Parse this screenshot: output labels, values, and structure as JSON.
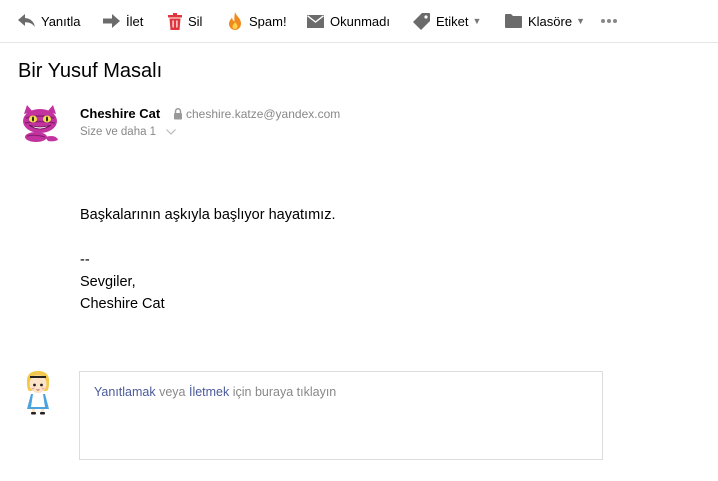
{
  "toolbar": {
    "reply": "Yanıtla",
    "forward": "İlet",
    "delete": "Sil",
    "spam": "Spam!",
    "unread": "Okunmadı",
    "label": "Etiket",
    "folder": "Klasöre",
    "more_icon": "more-dots-icon"
  },
  "colors": {
    "delete_red": "#e0353d",
    "spam_orange": "#f08a1c",
    "icon_gray": "#6b6b6b",
    "link_blue": "#4a5a9a",
    "muted": "#888888"
  },
  "message": {
    "subject": "Bir Yusuf Masalı",
    "sender_name": "Cheshire Cat",
    "sender_email": "cheshire.katze@yandex.com",
    "recipients": "Size ve daha 1",
    "body_line1": "Başkalarının aşkıyla başlıyor hayatımız.",
    "sig_sep": "--",
    "sig_greeting": "Sevgiler,",
    "sig_name": "Cheshire Cat"
  },
  "reply": {
    "reply_link": "Yanıtlamak",
    "or": " veya ",
    "forward_link": "İletmek",
    "rest": " için buraya tıklayın"
  }
}
